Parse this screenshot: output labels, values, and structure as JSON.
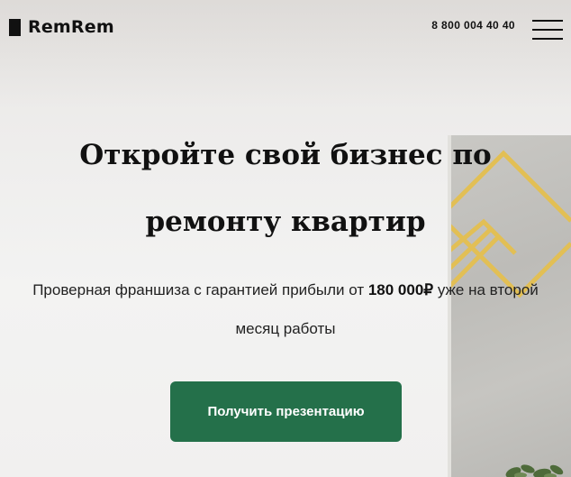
{
  "header": {
    "logo_text": "RemRem",
    "phone": "8 800 004 40 40"
  },
  "hero": {
    "title": "Откройте свой бизнес по ремонту квартир",
    "subtitle_before": "Проверная франшиза с гарантией прибыли от ",
    "subtitle_amount": "180 000₽",
    "subtitle_after": " уже на второй месяц работы",
    "cta_label": "Получить презентацию"
  },
  "colors": {
    "accent": "#24704a",
    "text": "#111111",
    "art_gold": "#e2bf55"
  },
  "icons": {
    "menu": "burger-menu-icon",
    "logo_mark": "logo-square-icon"
  }
}
